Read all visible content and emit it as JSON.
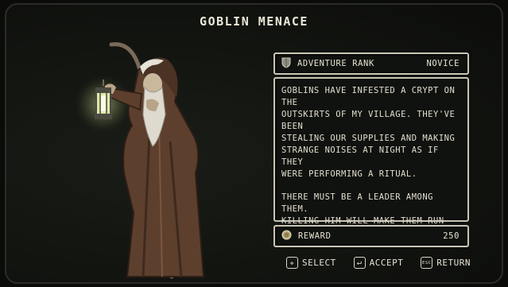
{
  "title": "GOBLIN MENACE",
  "rank": {
    "label": "ADVENTURE RANK",
    "value": "NOVICE",
    "icon": "shield-icon"
  },
  "description": {
    "paragraphs": [
      "GOBLINS HAVE INFESTED A CRYPT ON THE\nOUTSKIRTS OF MY VILLAGE. THEY'VE BEEN\nSTEALING OUR SUPPLIES AND MAKING\nSTRANGE NOISES AT NIGHT AS IF THEY\nWERE PERFORMING A RITUAL.",
      "THERE MUST BE A LEADER AMONG THEM.\nKILLING HIM WILL MAKE THEM RUN FOR\nTHEIR LIVES."
    ]
  },
  "reward": {
    "label": "REWARD",
    "value": "250",
    "icon": "coin-icon"
  },
  "controls": {
    "select": {
      "key_glyph": "✜",
      "label": "SELECT",
      "icon": "dpad-icon"
    },
    "accept": {
      "key_glyph": "↵",
      "label": "ACCEPT",
      "icon": "enter-key-icon"
    },
    "return": {
      "key_glyph": "ESC",
      "label": "RETURN",
      "icon": "esc-key-icon"
    }
  },
  "colors": {
    "panel_border": "#c9c6b6",
    "lantern_glow": "#f3e6a8",
    "robe": "#6b4a36",
    "background": "#121410"
  }
}
